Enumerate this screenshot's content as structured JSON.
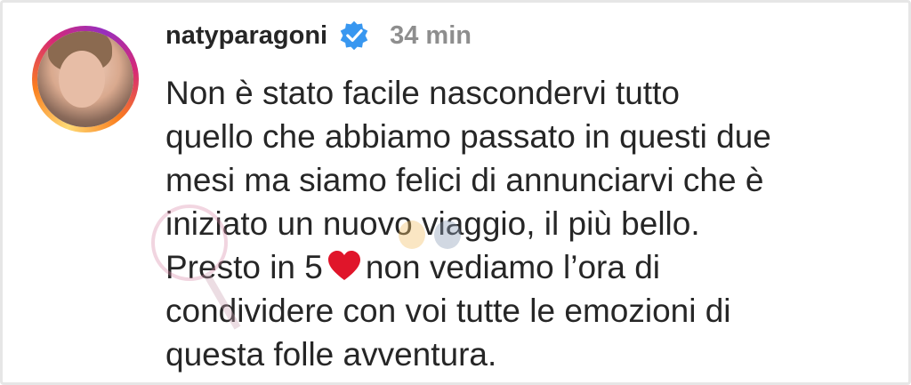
{
  "post": {
    "username": "natyparagoni",
    "time": "34 min",
    "caption_lines": [
      "Non è stato facile nascondervi tutto",
      "quello che abbiamo passato in questi due",
      "mesi ma siamo felici di annunciarvi che è",
      "iniziato un nuovo viaggio, il più bello.",
      "Presto in 5",
      "non vediamo l’ora di",
      "condividere con voi tutte le emozioni di",
      "questa folle avventura."
    ]
  },
  "icons": {
    "verified": "verified-badge-icon",
    "heart": "red-heart-icon"
  },
  "colors": {
    "verified": "#3897f0",
    "heart": "#e0152a",
    "time": "#8e8e8e"
  }
}
